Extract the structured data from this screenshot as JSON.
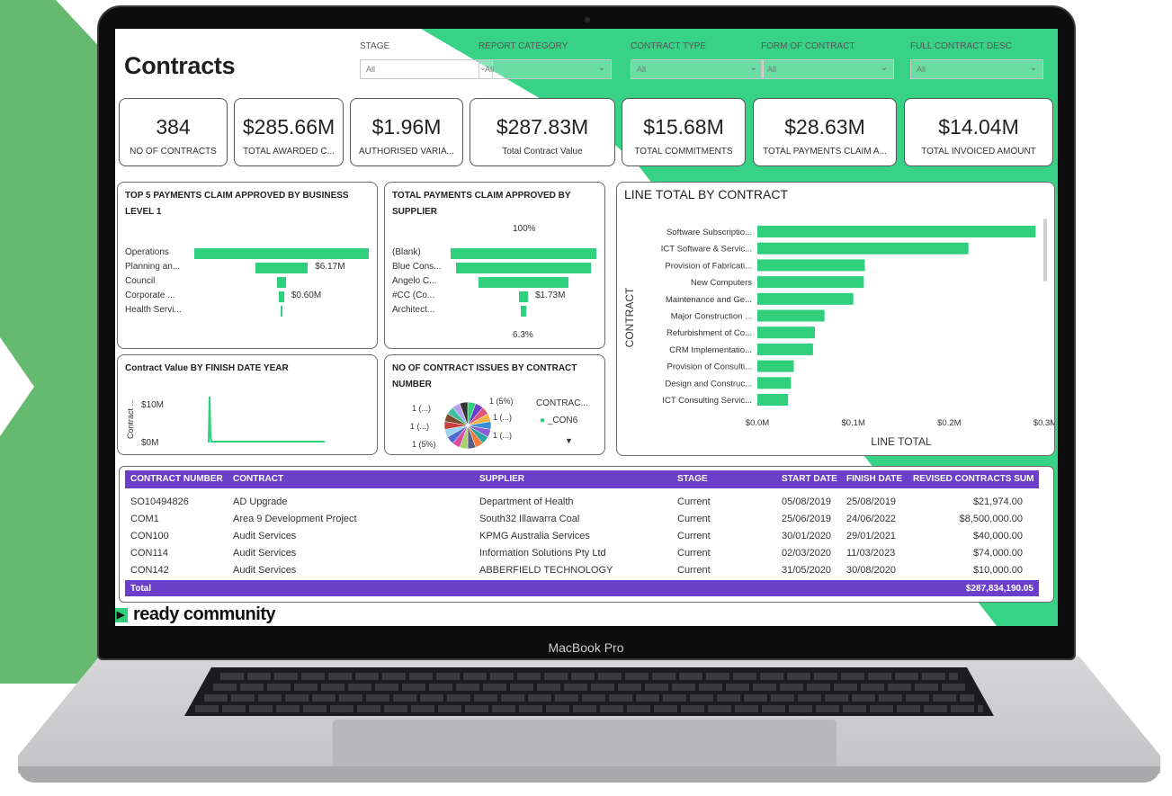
{
  "device": {
    "label": "MacBook Pro"
  },
  "dashboard": {
    "title": "Contracts",
    "filters": [
      {
        "label": "STAGE",
        "value": "All"
      },
      {
        "label": "REPORT CATEGORY",
        "value": "All"
      },
      {
        "label": "CONTRACT TYPE",
        "value": "All"
      },
      {
        "label": "FORM OF CONTRACT",
        "value": "All"
      },
      {
        "label": "FULL CONTRACT DESC",
        "value": "All"
      }
    ],
    "kpis": [
      {
        "value": "384",
        "label": "NO OF CONTRACTS"
      },
      {
        "value": "$285.66M",
        "label": "TOTAL AWARDED C..."
      },
      {
        "value": "$1.96M",
        "label": "AUTHORISED VARIA..."
      },
      {
        "value": "$287.83M",
        "label": "Total Contract Value"
      },
      {
        "value": "$15.68M",
        "label": "TOTAL COMMITMENTS"
      },
      {
        "value": "$28.63M",
        "label": "TOTAL PAYMENTS CLAIM A..."
      },
      {
        "value": "$14.04M",
        "label": "TOTAL INVOICED AMOUNT"
      }
    ],
    "funnel_business": {
      "title_line1": "TOP 5 PAYMENTS CLAIM APPROVED BY BUSINESS",
      "title_line2": "LEVEL 1",
      "categories": [
        "Operations",
        "Planning an...",
        "Council",
        "Corporate ...",
        "Health Servi..."
      ],
      "values": [
        20.5,
        6.17,
        1.0,
        0.6,
        0.15
      ],
      "labels": [
        "",
        "$6.17M",
        "",
        "$0.60M",
        ""
      ]
    },
    "funnel_supplier": {
      "title_line1": "TOTAL PAYMENTS CLAIM APPROVED BY",
      "title_line2": "SUPPLIER",
      "top_label": "100%",
      "bottom_label": "6.3%",
      "categories": [
        "(Blank)",
        "Blue Cons...",
        "Angelo C...",
        "#CC (Co...",
        "Architect..."
      ],
      "values": [
        27.5,
        25.5,
        17.0,
        1.73,
        0.9
      ],
      "labels": [
        "",
        "",
        "",
        "$1.73M",
        ""
      ]
    },
    "line_chart": {
      "title": "Contract Value BY FINISH DATE YEAR",
      "ylabel": "Contract ...",
      "ticks": [
        "$10M",
        "$0M"
      ]
    },
    "pie": {
      "title_line1": "NO OF CONTRACT ISSUES BY CONTRACT",
      "title_line2": "NUMBER",
      "labels": [
        "1 (5%)",
        "1 (...)",
        "1 (...)",
        "1 (...)",
        "1 (...)",
        "1 (5%)"
      ],
      "legend_title": "CONTRAC...",
      "legend_item": "_CON6",
      "slice_colors": [
        "#2fcf7c",
        "#6b3fc9",
        "#e0567a",
        "#f2b544",
        "#3b8fd9",
        "#8e5bd6",
        "#2aa8a0",
        "#f07c3a",
        "#5c5c8a",
        "#a3d36b",
        "#d94c9e",
        "#4d6bd1",
        "#9bd6f0",
        "#c94040",
        "#7a4a2a",
        "#41c0a0",
        "#b6a1e8",
        "#333333"
      ]
    }
  },
  "chart_data": {
    "type": "bar",
    "title": "LINE TOTAL BY CONTRACT",
    "xlabel": "LINE TOTAL",
    "ylabel": "CONTRACT",
    "categories": [
      "Software Subscriptio...",
      "ICT Software & Servic...",
      "Provision of Fabricati...",
      "New Computers",
      "Maintenance and Ge...",
      "Major Construction ...",
      "Refurbishment of Co...",
      "CRM Implementatio...",
      "Provision of Consulti...",
      "Design and Construc...",
      "ICT Consulting Servic..."
    ],
    "values": [
      0.29,
      0.22,
      0.112,
      0.111,
      0.1,
      0.07,
      0.06,
      0.058,
      0.038,
      0.035,
      0.032
    ],
    "xlim": [
      0,
      0.3
    ],
    "xticks": [
      "$0.0M",
      "$0.1M",
      "$0.2M",
      "$0.3M"
    ],
    "orientation": "horizontal"
  },
  "table": {
    "headers": [
      "CONTRACT NUMBER",
      "CONTRACT",
      "SUPPLIER",
      "STAGE",
      "START DATE",
      "FINISH DATE",
      "REVISED CONTRACTS SUM"
    ],
    "rows": [
      [
        "SO10494826",
        "AD Upgrade",
        "Department of Health",
        "Current",
        "05/08/2019",
        "25/08/2019",
        "$21,974.00"
      ],
      [
        "COM1",
        "Area 9 Development Project",
        "South32 Illawarra Coal",
        "Current",
        "25/06/2019",
        "24/06/2022",
        "$8,500,000.00"
      ],
      [
        "CON100",
        "Audit Services",
        "KPMG Australia Services",
        "Current",
        "30/01/2020",
        "29/01/2021",
        "$40,000.00"
      ],
      [
        "CON114",
        "Audit Services",
        "Information Solutions Pty Ltd",
        "Current",
        "02/03/2020",
        "11/03/2023",
        "$74,000.00"
      ],
      [
        "CON142",
        "Audit Services",
        "ABBERFIELD TECHNOLOGY",
        "Current",
        "31/05/2020",
        "30/08/2020",
        "$10,000.00"
      ]
    ],
    "footer_label": "Total",
    "footer_value": "$287,834,190.05"
  },
  "brand": {
    "mark": "▶",
    "text": "ready community"
  },
  "colors": {
    "green": "#2fcf7c",
    "purple": "#6b3fc9",
    "bg_green": "#66ba6f"
  }
}
